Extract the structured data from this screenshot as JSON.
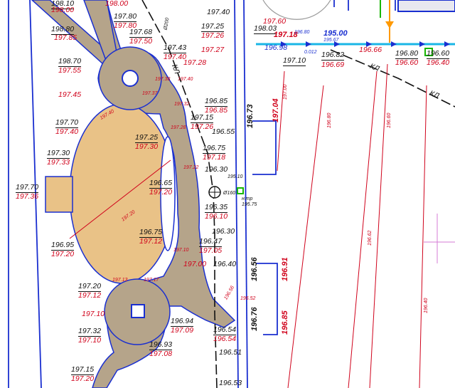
{
  "colors": {
    "paving": "#b5a48a",
    "lawn": "#e9c287",
    "boundary": "#1a2fd0",
    "existing_level": "#d0021b",
    "design_level": "#111111",
    "water_pipe": "#19b6e6",
    "tree_marker": "#17b600",
    "gas_pipe": "#ff9900"
  },
  "labels": {
    "l001": "198.10",
    "l002": "198.00",
    "l003": "198.00",
    "l004": "197.80",
    "l005": "197.80",
    "l006": "198.80",
    "l007": "197.85",
    "l008": "197.68",
    "l009": "197.50",
    "l010": "198.70",
    "l011": "197.55",
    "l012": "197.43",
    "l013": "197.40",
    "l014": "197.45",
    "l015": "197.25",
    "l016": "197.26",
    "l017": "197.27",
    "l018": "197.28",
    "l019": "196.85",
    "l020": "196.85",
    "l021": "197.15",
    "l022": "197.26",
    "l023": "196.55",
    "l024": "197.70",
    "l025": "197.40",
    "l026": "197.25",
    "l027": "197.30",
    "l028": "196.75",
    "l029": "197.18",
    "l030": "197.30",
    "l031": "197.33",
    "l032": "196.30",
    "l033": "195.10",
    "l034": "197.70",
    "l035": "197.36",
    "l036": "196.65",
    "l037": "197.20",
    "l038": "196.35",
    "l039": "196.10",
    "l040": "н.тр",
    "l041": "195.75",
    "l042": "196.30",
    "l043": "196.75",
    "l044": "197.12",
    "l045": "196.47",
    "l046": "197.05",
    "l047": "196.95",
    "l048": "197.20",
    "l049": "197.00",
    "l050": "196.40",
    "l051": "197.20",
    "l052": "197.12",
    "l053": "197.10",
    "l054": "196.94",
    "l055": "197.09",
    "l056": "196.54",
    "l057": "196.54",
    "l058": "196.51",
    "l059": "197.32",
    "l060": "197.10",
    "l061": "196.93",
    "l062": "197.08",
    "l063": "197.15",
    "l064": "197.20",
    "l065": "196.53",
    "l066": "197.40",
    "l067": "197.60",
    "l068": "198.03",
    "l069": "197.18",
    "l070": "196.98",
    "l071": "195.00",
    "l072": "196.82",
    "l073": "196.69",
    "l074": "196.66",
    "l075": "197.10",
    "l076": "196.80",
    "l077": "196.60",
    "l078": "196.60",
    "l079": "196.40",
    "l080": "196.73",
    "l081": "197.04",
    "l082": "196.56",
    "l083": "196.91",
    "l084": "196.76",
    "l085": "196.85",
    "l086": "КЛ",
    "l087": "КЛ",
    "l088": "КЛ",
    "l089": "Ø200",
    "l090": "Ø160",
    "l091": "197.00",
    "l092": "196.80",
    "l093": "196.60",
    "l094": "196.62",
    "l095": "196.40",
    "l096": "197.40",
    "l097": "197.20",
    "l098": "197.38",
    "l099": "197.40",
    "l100": "197.37",
    "l101": "197.32",
    "l102": "197.22",
    "l103": "197.28",
    "l104": "197.13",
    "l105": "197.17",
    "l106": "197.10",
    "l107": "196.52",
    "l108": "196.56",
    "l109": "196.80",
    "l110": "0.012",
    "l111": "195.67"
  }
}
